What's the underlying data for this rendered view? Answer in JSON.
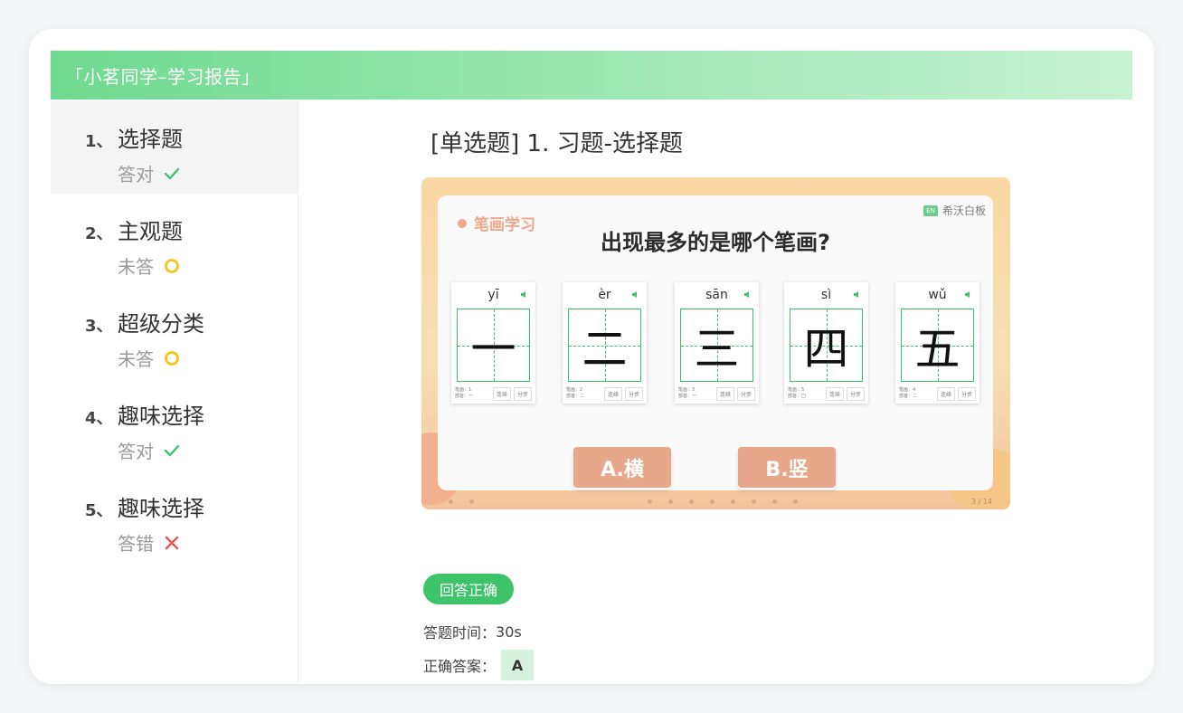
{
  "header": {
    "title": "「小茗同学–学习报告」"
  },
  "sidebar": {
    "items": [
      {
        "num": "1、",
        "label": "选择题",
        "status": "答对",
        "status_icon": "check-icon"
      },
      {
        "num": "2、",
        "label": "主观题",
        "status": "未答",
        "status_icon": "circle-icon"
      },
      {
        "num": "3、",
        "label": "超级分类",
        "status": "未答",
        "status_icon": "circle-icon"
      },
      {
        "num": "4、",
        "label": "趣味选择",
        "status": "答对",
        "status_icon": "check-icon"
      },
      {
        "num": "5、",
        "label": "趣味选择",
        "status": "答错",
        "status_icon": "cross-icon"
      }
    ]
  },
  "main": {
    "question_title": "[单选题] 1. 习题-选择题",
    "slide": {
      "tag": "笔画学习",
      "brand": "希沃白板",
      "brand_logo": "EN",
      "question": "出现最多的是哪个笔画?",
      "cards": [
        {
          "pinyin": "yī",
          "char": "一",
          "stroke_count": "笔画：1",
          "radical": "部首：一"
        },
        {
          "pinyin": "èr",
          "char": "二",
          "stroke_count": "笔画：2",
          "radical": "部首：二"
        },
        {
          "pinyin": "sān",
          "char": "三",
          "stroke_count": "笔画：3",
          "radical": "部首：一"
        },
        {
          "pinyin": "sì",
          "char": "四",
          "stroke_count": "笔画：5",
          "radical": "部首：囗"
        },
        {
          "pinyin": "wǔ",
          "char": "五",
          "stroke_count": "笔画：4",
          "radical": "部首：二"
        }
      ],
      "card_btn_continuous": "连续",
      "card_btn_step": "分步",
      "options": [
        "A.横",
        "B.竖"
      ],
      "page_indicator": "3 / 14"
    },
    "result_badge": "回答正确",
    "time_label": "答题时间：",
    "time_value": "30s",
    "answer_label": "正确答案：",
    "answer_value": "A"
  },
  "colors": {
    "accent_green": "#3ec36a",
    "header_gradient_start": "#6fd98f",
    "warning_yellow": "#f5c518",
    "error_red": "#e85555",
    "option_salmon": "#e7a78a"
  }
}
